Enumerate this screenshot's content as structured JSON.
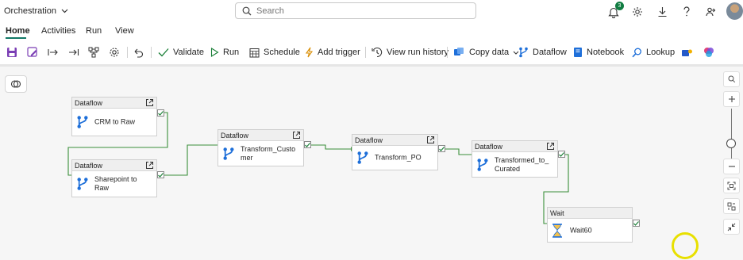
{
  "app": {
    "title": "Orchestration"
  },
  "search": {
    "placeholder": "Search"
  },
  "notifications": {
    "count": "3"
  },
  "tabs": [
    "Home",
    "Activities",
    "Run",
    "View"
  ],
  "toolbar": {
    "validate": "Validate",
    "run": "Run",
    "schedule": "Schedule",
    "add_trigger": "Add trigger",
    "view_run_history": "View run history",
    "copy_data": "Copy data",
    "dataflow": "Dataflow",
    "notebook": "Notebook",
    "lookup": "Lookup"
  },
  "nodes": {
    "crm": {
      "type": "Dataflow",
      "label": "CRM to Raw"
    },
    "sharepoint": {
      "type": "Dataflow",
      "label": "Sharepoint to Raw"
    },
    "transform_customer": {
      "type": "Dataflow",
      "label": "Transform_Customer"
    },
    "transform_po": {
      "type": "Dataflow",
      "label": "Transform_PO"
    },
    "transformed_to_curated": {
      "type": "Dataflow",
      "label": "Transformed_to_Curated"
    },
    "wait60": {
      "type": "Wait",
      "label": "Wait60"
    }
  },
  "colors": {
    "accent": "#117865",
    "connector": "#3a8f3a",
    "dataflow_icon": "#1e6fd9"
  }
}
